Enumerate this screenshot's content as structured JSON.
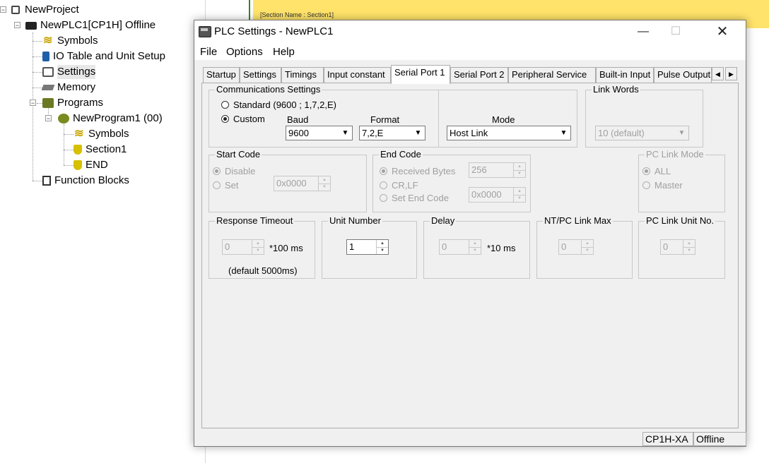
{
  "tree": {
    "project": "NewProject",
    "plc": "NewPLC1[CP1H] Offline",
    "symbols": "Symbols",
    "io_table": "IO Table and Unit Setup",
    "settings": "Settings",
    "memory": "Memory",
    "programs": "Programs",
    "program1": "NewProgram1 (00)",
    "prog_symbols": "Symbols",
    "section1": "Section1",
    "end": "END",
    "function_blocks": "Function Blocks",
    "expand_glyph": "−"
  },
  "background_editor": {
    "section_label": "[Section Name : Section1]"
  },
  "window": {
    "title": "PLC Settings - NewPLC1",
    "minimize": "—",
    "maximize": "☐",
    "close": "✕"
  },
  "menu": [
    "File",
    "Options",
    "Help"
  ],
  "tabs": [
    "Startup",
    "Settings",
    "Timings",
    "Input constant",
    "Serial Port 1",
    "Serial Port 2",
    "Peripheral Service",
    "Built-in Input",
    "Pulse Output"
  ],
  "active_tab": "Serial Port 1",
  "tab_scroll": {
    "left": "◀",
    "right": "▶"
  },
  "comm": {
    "label": "Communications Settings",
    "standard": "Standard (9600 ; 1,7,2,E)",
    "custom": "Custom",
    "baud_label": "Baud",
    "baud_value": "9600",
    "format_label": "Format",
    "format_value": "7,2,E",
    "mode_label": "Mode",
    "mode_value": "Host Link",
    "selected": "custom"
  },
  "link_words": {
    "label": "Link Words",
    "value": "10 (default)"
  },
  "start_code": {
    "label": "Start Code",
    "disable": "Disable",
    "set": "Set",
    "value": "0x0000"
  },
  "end_code": {
    "label": "End Code",
    "received_bytes": "Received Bytes",
    "received_value": "256",
    "crlf": "CR,LF",
    "set_end_code": "Set End Code",
    "value": "0x0000"
  },
  "pc_link_mode": {
    "label": "PC Link Mode",
    "all": "ALL",
    "master": "Master"
  },
  "response_timeout": {
    "label": "Response Timeout",
    "value": "0",
    "unit": "*100 ms",
    "default": "(default 5000ms)"
  },
  "unit_number": {
    "label": "Unit Number",
    "value": "1"
  },
  "delay": {
    "label": "Delay",
    "value": "0",
    "unit": "*10 ms"
  },
  "nt_pc_link_max": {
    "label": "NT/PC Link Max",
    "value": "0"
  },
  "pc_link_unit_no": {
    "label": "PC Link Unit No.",
    "value": "0"
  },
  "status": {
    "model": "CP1H-XA",
    "state": "Offline"
  },
  "glyphs": {
    "dropdown": "▼",
    "spin_up": "▲",
    "spin_down": "▼"
  }
}
